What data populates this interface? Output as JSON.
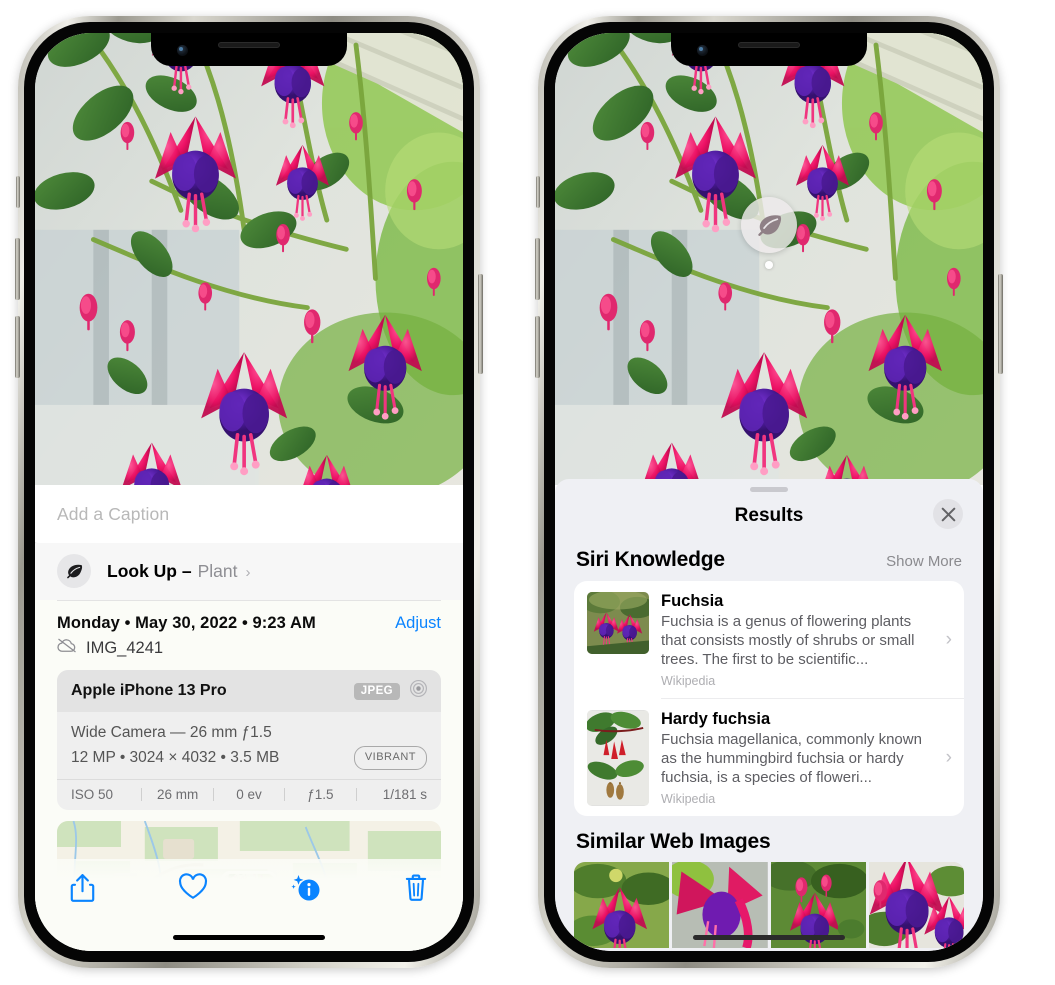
{
  "left_phone": {
    "caption_placeholder": "Add a Caption",
    "lookup": {
      "label": "Look Up –",
      "kind": "Plant",
      "chevron": "›",
      "icon": "leaf-icon"
    },
    "date_text": "Monday • May 30, 2022 • 9:23 AM",
    "adjust_label": "Adjust",
    "file_name": "IMG_4241",
    "file_icon": "cloud-slash-icon",
    "exif": {
      "device": "Apple iPhone 13 Pro",
      "format_badge": "JPEG",
      "lens_icon": "aperture-icon",
      "lens_line": "Wide Camera — 26 mm ƒ1.5",
      "size_line": "12 MP • 3024 × 4032 • 3.5 MB",
      "style_badge": "VIBRANT",
      "stats": [
        "ISO 50",
        "26 mm",
        "0 ev",
        "ƒ1.5",
        "1/181 s"
      ]
    },
    "toolbar": [
      {
        "name": "share-button",
        "icon": "share-icon"
      },
      {
        "name": "favorite-button",
        "icon": "heart-icon"
      },
      {
        "name": "info-button",
        "icon": "info-sparkle-icon"
      },
      {
        "name": "delete-button",
        "icon": "trash-icon"
      }
    ],
    "accent_color": "#0a84ff"
  },
  "right_phone": {
    "visual_lookup_badge": {
      "icon": "leaf-icon"
    },
    "sheet": {
      "title": "Results",
      "close_icon": "close-icon",
      "siri_section": {
        "title": "Siri Knowledge",
        "show_more": "Show More",
        "items": [
          {
            "title": "Fuchsia",
            "description": "Fuchsia is a genus of flowering plants that consists mostly of shrubs or small trees. The first to be scientific...",
            "source": "Wikipedia",
            "chevron": "›"
          },
          {
            "title": "Hardy fuchsia",
            "description": "Fuchsia magellanica, commonly known as the hummingbird fuchsia or hardy fuchsia, is a species of floweri...",
            "source": "Wikipedia",
            "chevron": "›"
          }
        ]
      },
      "similar_section": {
        "title": "Similar Web Images",
        "thumbnails": [
          "web-image-1",
          "web-image-2",
          "web-image-3",
          "web-image-4"
        ]
      }
    }
  }
}
